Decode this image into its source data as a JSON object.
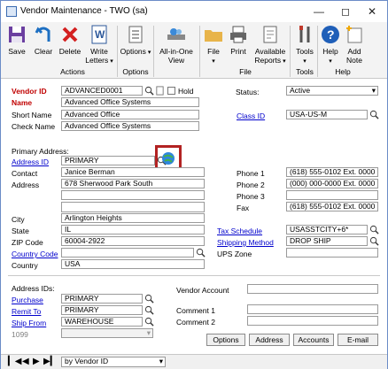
{
  "window": {
    "title": "Vendor Maintenance  -  TWO (sa)"
  },
  "ribbon": {
    "buttons": {
      "save": "Save",
      "clear": "Clear",
      "delete": "Delete",
      "write_letters": "Write Letters",
      "options": "Options",
      "all_in_one": "All-in-One View",
      "file": "File",
      "print": "Print",
      "available_reports": "Available Reports",
      "tools": "Tools",
      "help": "Help",
      "add_note": "Add Note"
    },
    "groups": {
      "actions": "Actions",
      "options": "Options",
      "file": "File",
      "tools": "Tools",
      "help": "Help"
    }
  },
  "form": {
    "vendor_id_label": "Vendor ID",
    "vendor_id": "ADVANCED0001",
    "hold_label": "Hold",
    "name_label": "Name",
    "name": "Advanced Office Systems",
    "short_name_label": "Short Name",
    "short_name": "Advanced Office",
    "check_name_label": "Check Name",
    "check_name": "Advanced Office Systems",
    "status_label": "Status:",
    "status": "Active",
    "class_id_label": "Class ID",
    "class_id": "USA-US-M",
    "primary_address_label": "Primary Address:",
    "address_id_label": "Address ID",
    "address_id": "PRIMARY",
    "contact_label": "Contact",
    "contact": "Janice Berman",
    "address_label": "Address",
    "address1": "678 Sherwood Park South",
    "address2": "",
    "address3": "",
    "city_label": "City",
    "city": "Arlington Heights",
    "state_label": "State",
    "state": "IL",
    "zip_label": "ZIP Code",
    "zip": "60004-2922",
    "country_code_label": "Country Code",
    "country_code": "",
    "country_label": "Country",
    "country": "USA",
    "phone1_label": "Phone 1",
    "phone1": "(618) 555-0102  Ext. 0000",
    "phone2_label": "Phone 2",
    "phone2": "(000) 000-0000  Ext. 0000",
    "phone3_label": "Phone 3",
    "phone3": "",
    "fax_label": "Fax",
    "fax": "(618) 555-0102  Ext. 0000",
    "tax_schedule_label": "Tax Schedule",
    "tax_schedule": "USASSTCITY+6*",
    "shipping_method_label": "Shipping Method",
    "shipping_method": "DROP SHIP",
    "ups_zone_label": "UPS Zone",
    "ups_zone": "",
    "address_ids_label": "Address IDs:",
    "purchase_label": "Purchase",
    "purchase": "PRIMARY",
    "remit_to_label": "Remit To",
    "remit_to": "PRIMARY",
    "ship_from_label": "Ship From",
    "ship_from": "WAREHOUSE",
    "label_1099": "1099",
    "vendor_account_label": "Vendor Account",
    "vendor_account": "",
    "comment1_label": "Comment 1",
    "comment1": "",
    "comment2_label": "Comment 2",
    "comment2": ""
  },
  "bottom_buttons": {
    "options": "Options",
    "address": "Address",
    "accounts": "Accounts",
    "email": "E-mail"
  },
  "statusbar": {
    "sort": "by Vendor ID"
  },
  "colors": {
    "highlight_box": "#b22222",
    "link": "#0000cc",
    "required": "#c00000"
  }
}
